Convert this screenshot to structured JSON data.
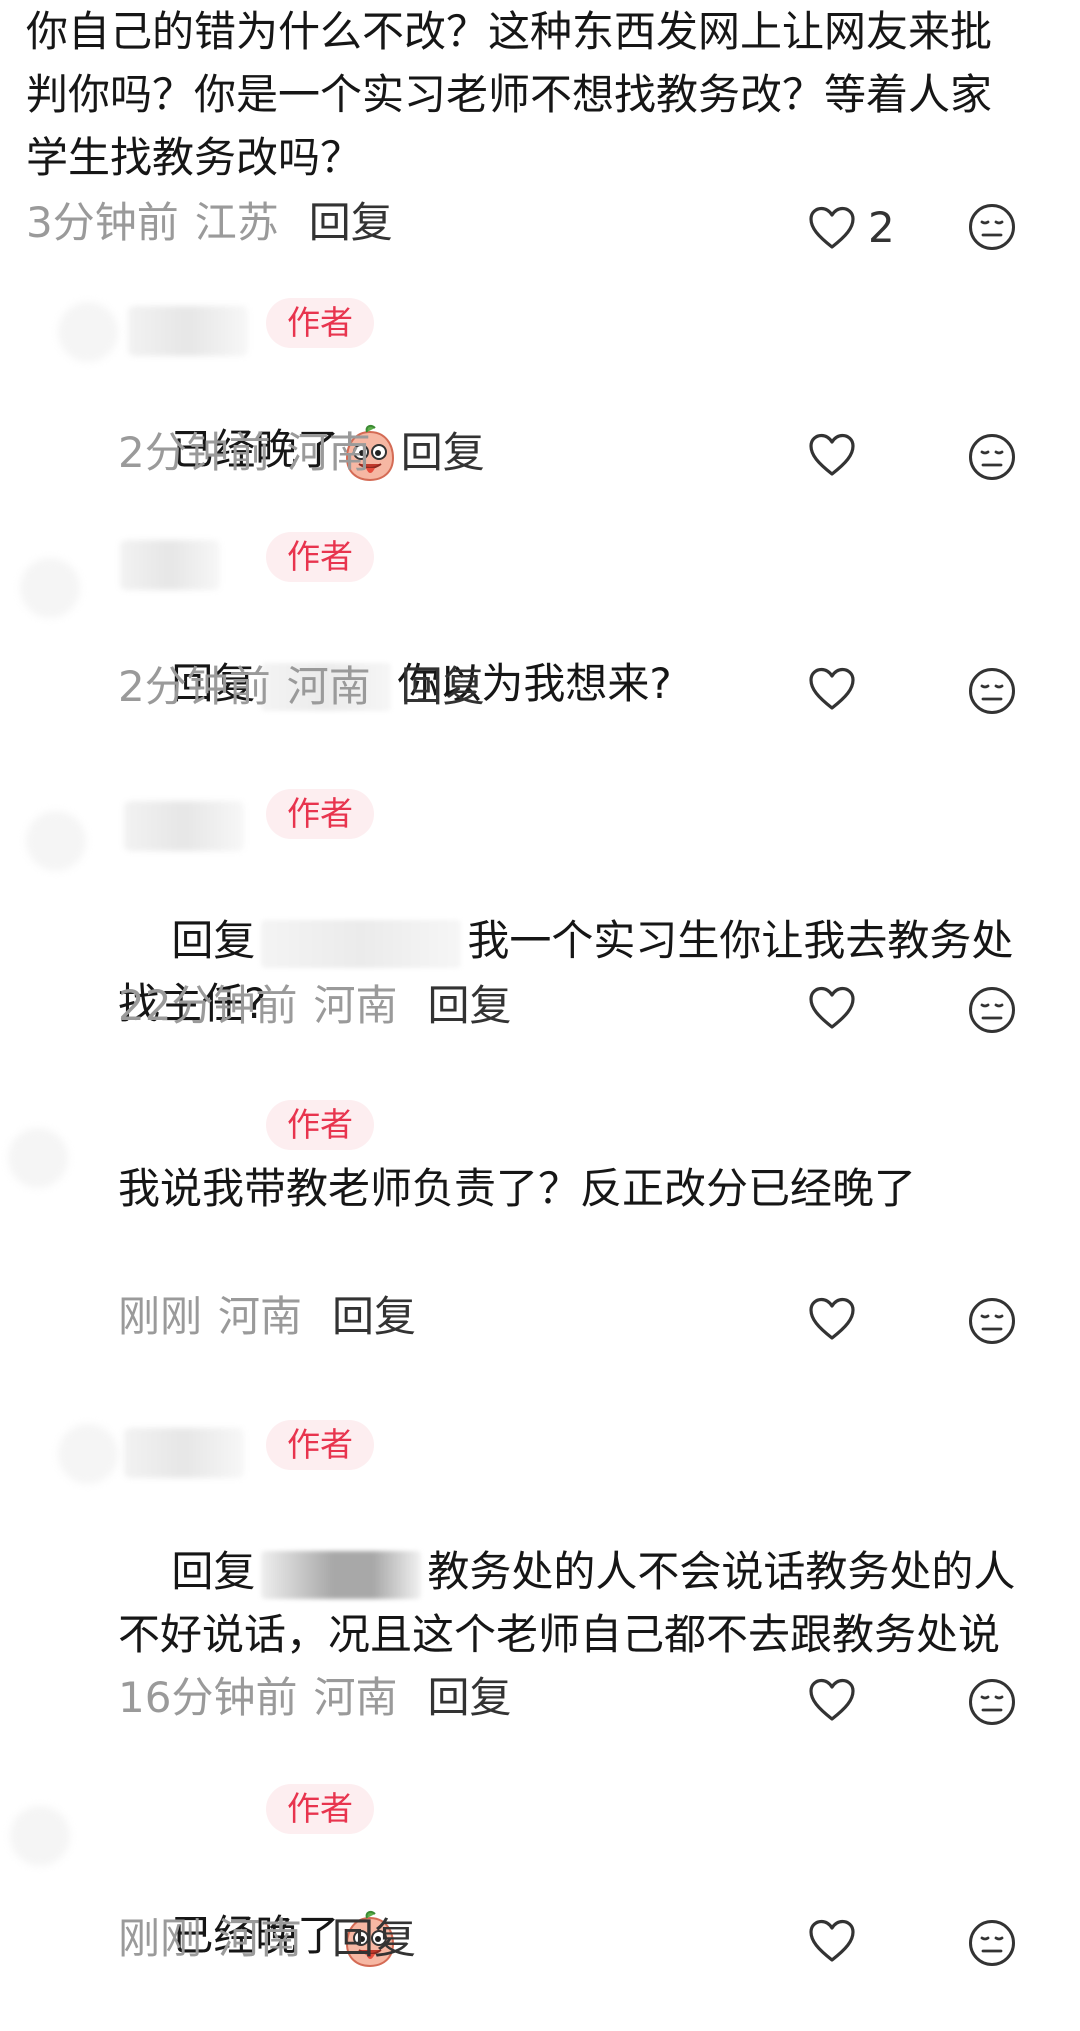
{
  "comments": [
    {
      "text": "你自己的错为什么不改？这种东西发网上让网友来批判你吗？你是一个实习老师不想找教务改？等着人家学生找教务改吗？",
      "time": "3分钟前",
      "location": "江苏",
      "reply_label": "回复",
      "likes": "2"
    },
    {
      "badge": "作者",
      "text": "已经晚了",
      "time": "2分钟前",
      "location": "河南",
      "reply_label": "回复"
    },
    {
      "badge": "作者",
      "reply_prefix": "回复",
      "text": "你以为我想来?",
      "time": "2分钟前",
      "location": "河南",
      "reply_label": "回复"
    },
    {
      "badge": "作者",
      "reply_prefix": "回复",
      "text": "我一个实习生你让我去教务处找主任?",
      "time": "22分钟前",
      "location": "河南",
      "reply_label": "回复"
    },
    {
      "badge": "作者",
      "text": "我说我带教老师负责了？反正改分已经晚了",
      "time": "刚刚",
      "location": "河南",
      "reply_label": "回复"
    },
    {
      "badge": "作者",
      "reply_prefix": "回复",
      "text": "教务处的人不会说话教务处的人不好说话，况且这个老师自己都不去跟教务处说",
      "time": "16分钟前",
      "location": "河南",
      "reply_label": "回复"
    },
    {
      "badge": "作者",
      "text": "已经晚了",
      "time": "刚刚",
      "location": "河南",
      "reply_label": "回复"
    }
  ],
  "icons": {
    "like": "heart-outline-icon",
    "dislike": "meh-face-icon",
    "emoji": "tongue-out-peach-emoji"
  },
  "colors": {
    "badge_text": "#e8344e",
    "badge_bg": "#fdeef0",
    "meta_text": "#9a9a9a",
    "body_text": "#161616"
  }
}
